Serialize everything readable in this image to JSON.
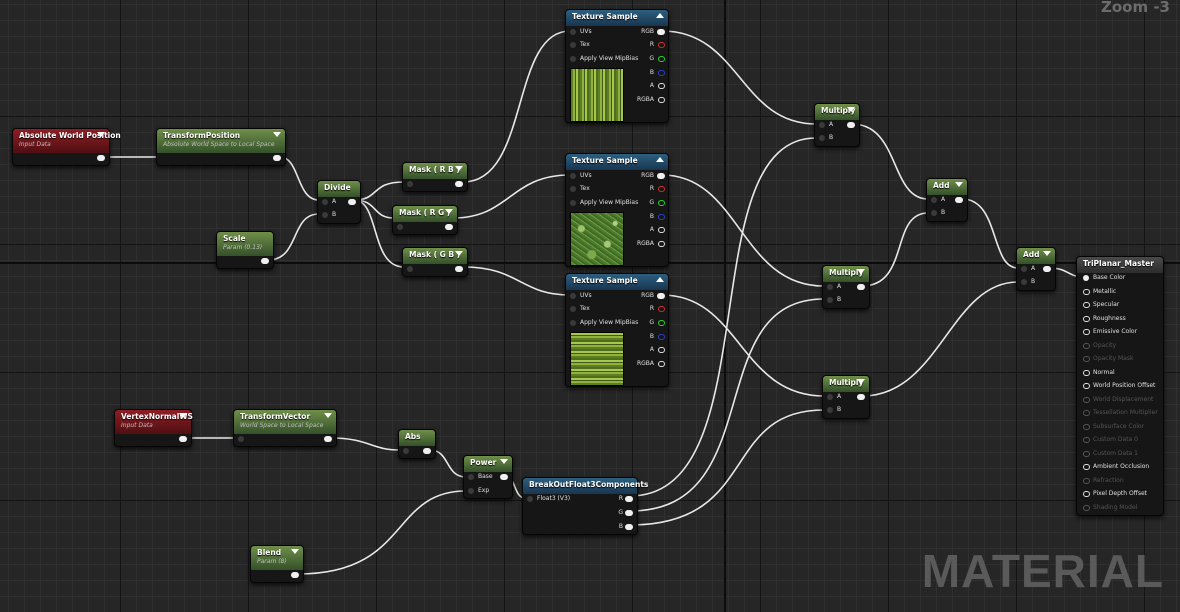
{
  "zoom": "Zoom -3",
  "watermark": "MATERIAL",
  "nodes": {
    "abs_world_pos": {
      "title": "Absolute World Position",
      "subtitle": "Input Data"
    },
    "transform_position": {
      "title": "TransformPosition",
      "subtitle": "Absolute World Space to Local Space"
    },
    "scale": {
      "title": "Scale",
      "subtitle": "Param (0.13)"
    },
    "divide": {
      "title": "Divide",
      "pin_a": "A",
      "pin_b": "B"
    },
    "mask_rb": {
      "title": "Mask ( R B )"
    },
    "mask_rg": {
      "title": "Mask ( R G )"
    },
    "mask_gb": {
      "title": "Mask ( G B )"
    },
    "tex1": {
      "title": "Texture Sample",
      "inputs": [
        "UVs",
        "Tex",
        "Apply View MipBias"
      ],
      "outputs": [
        "RGB",
        "R",
        "G",
        "B",
        "A",
        "RGBA"
      ]
    },
    "tex2": {
      "title": "Texture Sample",
      "inputs": [
        "UVs",
        "Tex",
        "Apply View MipBias"
      ],
      "outputs": [
        "RGB",
        "R",
        "G",
        "B",
        "A",
        "RGBA"
      ]
    },
    "tex3": {
      "title": "Texture Sample",
      "inputs": [
        "UVs",
        "Tex",
        "Apply View MipBias"
      ],
      "outputs": [
        "RGB",
        "R",
        "G",
        "B",
        "A",
        "RGBA"
      ]
    },
    "multiply1": {
      "title": "Multiply",
      "pin_a": "A",
      "pin_b": "B"
    },
    "multiply2": {
      "title": "Multiply",
      "pin_a": "A",
      "pin_b": "B"
    },
    "multiply3": {
      "title": "Multiply",
      "pin_a": "A",
      "pin_b": "B"
    },
    "add1": {
      "title": "Add",
      "pin_a": "A",
      "pin_b": "B"
    },
    "add2": {
      "title": "Add",
      "pin_a": "A",
      "pin_b": "B"
    },
    "vertex_normal": {
      "title": "VertexNormalWS",
      "subtitle": "Input Data"
    },
    "transform_vector": {
      "title": "TransformVector",
      "subtitle": "World Space to Local Space"
    },
    "abs": {
      "title": "Abs"
    },
    "power": {
      "title": "Power",
      "pin_base": "Base",
      "pin_exp": "Exp"
    },
    "breakout": {
      "title": "BreakOutFloat3Components",
      "input": "Float3 (V3)",
      "outputs": [
        "R",
        "G",
        "B"
      ]
    },
    "blend": {
      "title": "Blend",
      "subtitle": "Param (8)"
    },
    "master": {
      "title": "TriPlanar_Master",
      "pins": [
        {
          "label": "Base Color",
          "active": true
        },
        {
          "label": "Metallic",
          "active": true
        },
        {
          "label": "Specular",
          "active": true
        },
        {
          "label": "Roughness",
          "active": true
        },
        {
          "label": "Emissive Color",
          "active": true
        },
        {
          "label": "Opacity",
          "active": false
        },
        {
          "label": "Opacity Mask",
          "active": false
        },
        {
          "label": "Normal",
          "active": true
        },
        {
          "label": "World Position Offset",
          "active": true
        },
        {
          "label": "World Displacement",
          "active": false
        },
        {
          "label": "Tessellation Multiplier",
          "active": false
        },
        {
          "label": "Subsurface Color",
          "active": false
        },
        {
          "label": "Custom Data 0",
          "active": false
        },
        {
          "label": "Custom Data 1",
          "active": false
        },
        {
          "label": "Ambient Occlusion",
          "active": true
        },
        {
          "label": "Refraction",
          "active": false
        },
        {
          "label": "Pixel Depth Offset",
          "active": true
        },
        {
          "label": "Shading Model",
          "active": false
        }
      ]
    }
  }
}
